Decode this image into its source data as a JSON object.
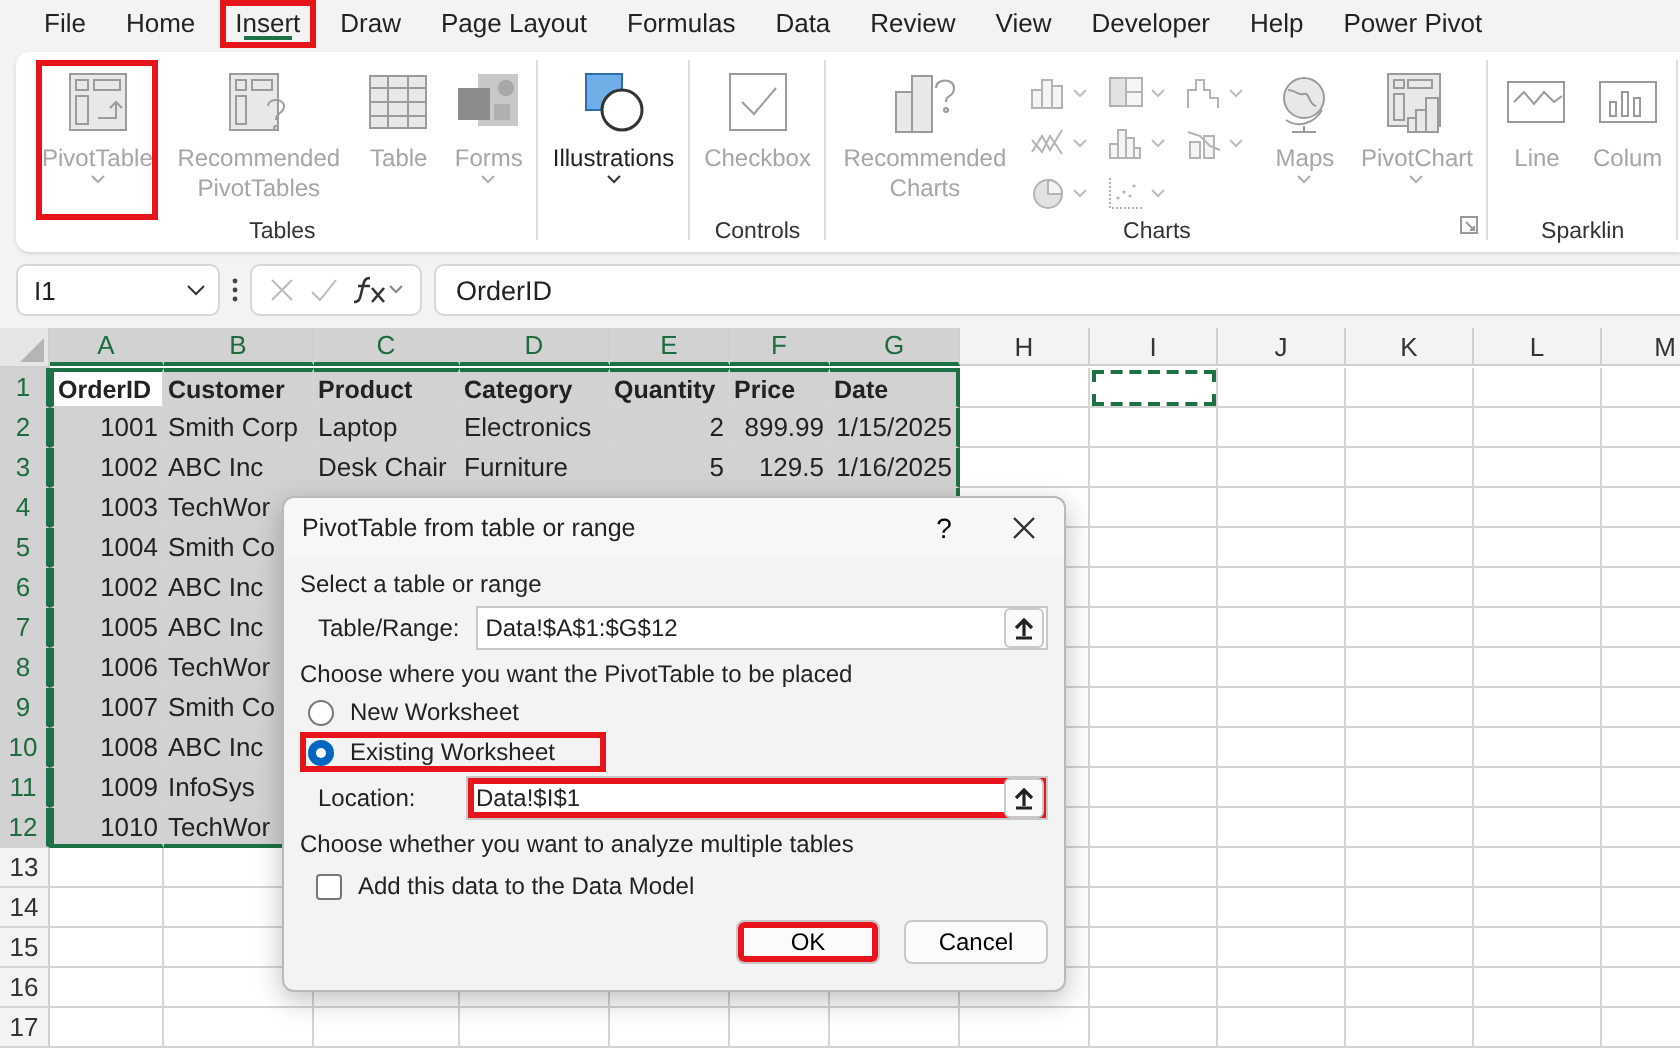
{
  "menu_tabs": [
    {
      "label": "File",
      "selected": false,
      "highlighted": false
    },
    {
      "label": "Home",
      "selected": false,
      "highlighted": false
    },
    {
      "label": "Insert",
      "selected": true,
      "highlighted": true
    },
    {
      "label": "Draw",
      "selected": false,
      "highlighted": false
    },
    {
      "label": "Page Layout",
      "selected": false,
      "highlighted": false
    },
    {
      "label": "Formulas",
      "selected": false,
      "highlighted": false
    },
    {
      "label": "Data",
      "selected": false,
      "highlighted": false
    },
    {
      "label": "Review",
      "selected": false,
      "highlighted": false
    },
    {
      "label": "View",
      "selected": false,
      "highlighted": false
    },
    {
      "label": "Developer",
      "selected": false,
      "highlighted": false
    },
    {
      "label": "Help",
      "selected": false,
      "highlighted": false
    },
    {
      "label": "Power Pivot",
      "selected": false,
      "highlighted": false
    }
  ],
  "ribbon": {
    "groups": [
      {
        "label": "Tables",
        "items": [
          {
            "kind": "pivottable",
            "label": "PivotTable",
            "dropdown": true,
            "disabled": true,
            "highlighted": true
          },
          {
            "kind": "recommended",
            "label": "Recommended PivotTables",
            "dropdown": false,
            "disabled": true,
            "highlighted": false
          },
          {
            "kind": "table",
            "label": "Table",
            "dropdown": false,
            "disabled": true,
            "highlighted": false
          },
          {
            "kind": "forms",
            "label": "Forms",
            "dropdown": true,
            "disabled": true,
            "highlighted": false
          }
        ]
      },
      {
        "items": [
          {
            "kind": "illustrations",
            "label": "Illustrations",
            "dropdown": true,
            "disabled": false,
            "highlighted": false
          }
        ]
      },
      {
        "label": "Controls",
        "items": [
          {
            "kind": "checkbox",
            "label": "Checkbox",
            "dropdown": false,
            "disabled": true,
            "highlighted": false
          }
        ]
      },
      {
        "label": "Charts",
        "launcher": true,
        "items": [
          {
            "kind": "recchart",
            "label": "Recommended Charts",
            "dropdown": false,
            "disabled": true,
            "highlighted": false
          },
          {
            "kind": "gallery",
            "disabled": true
          },
          {
            "kind": "maps",
            "label": "Maps",
            "dropdown": true,
            "disabled": true,
            "highlighted": false
          },
          {
            "kind": "pivotchart",
            "label": "PivotChart",
            "dropdown": true,
            "disabled": true,
            "highlighted": false
          }
        ]
      },
      {
        "label": "Sparklin",
        "items": [
          {
            "kind": "sparkline",
            "label": "Line",
            "dropdown": false,
            "disabled": true,
            "highlighted": false
          },
          {
            "kind": "sparkcolumn",
            "label": "Colum",
            "dropdown": false,
            "disabled": true,
            "highlighted": false
          }
        ]
      }
    ]
  },
  "formula_bar": {
    "name_box": "I1",
    "formula": "OrderID"
  },
  "sheet": {
    "marquee": true,
    "columns": [
      {
        "label": "A",
        "selected": true,
        "numeric": true
      },
      {
        "label": "B",
        "selected": true,
        "numeric": false
      },
      {
        "label": "C",
        "selected": true,
        "numeric": false
      },
      {
        "label": "D",
        "selected": true,
        "numeric": false
      },
      {
        "label": "E",
        "selected": true,
        "numeric": true
      },
      {
        "label": "F",
        "selected": true,
        "numeric": true
      },
      {
        "label": "G",
        "selected": true,
        "numeric": true
      },
      {
        "label": "H",
        "selected": false
      },
      {
        "label": "I",
        "selected": false
      },
      {
        "label": "J",
        "selected": false
      },
      {
        "label": "K",
        "selected": false
      },
      {
        "label": "L",
        "selected": false
      },
      {
        "label": "M",
        "selected": false
      }
    ],
    "rows": [
      {
        "label": "1",
        "selected": true,
        "kind": "header",
        "cells": [
          "OrderID",
          "Customer",
          "Product",
          "Category",
          "Quantity",
          "Price",
          "Date"
        ]
      },
      {
        "label": "2",
        "selected": true,
        "kind": "data",
        "cells": [
          "1001",
          "Smith Corp",
          "Laptop",
          "Electronics",
          "2",
          "899.99",
          "1/15/2025"
        ]
      },
      {
        "label": "3",
        "selected": true,
        "kind": "data",
        "cells": [
          "1002",
          "ABC Inc",
          "Desk Chair",
          "Furniture",
          "5",
          "129.5",
          "1/16/2025"
        ]
      },
      {
        "label": "4",
        "selected": true,
        "kind": "data",
        "cells": [
          "1003",
          "TechWor"
        ]
      },
      {
        "label": "5",
        "selected": true,
        "kind": "data",
        "cells": [
          "1004",
          "Smith Co"
        ]
      },
      {
        "label": "6",
        "selected": true,
        "kind": "data",
        "cells": [
          "1002",
          "ABC Inc"
        ]
      },
      {
        "label": "7",
        "selected": true,
        "kind": "data",
        "cells": [
          "1005",
          "ABC Inc"
        ]
      },
      {
        "label": "8",
        "selected": true,
        "kind": "data",
        "cells": [
          "1006",
          "TechWor"
        ]
      },
      {
        "label": "9",
        "selected": true,
        "kind": "data",
        "cells": [
          "1007",
          "Smith Co"
        ]
      },
      {
        "label": "10",
        "selected": true,
        "kind": "data",
        "cells": [
          "1008",
          "ABC Inc"
        ]
      },
      {
        "label": "11",
        "selected": true,
        "kind": "data",
        "cells": [
          "1009",
          "InfoSys"
        ]
      },
      {
        "label": "12",
        "selected": true,
        "kind": "data",
        "cells": [
          "1010",
          "TechWor"
        ]
      },
      {
        "label": "13",
        "selected": false,
        "kind": "data"
      },
      {
        "label": "14",
        "selected": false,
        "kind": "data"
      },
      {
        "label": "15",
        "selected": false,
        "kind": "data"
      },
      {
        "label": "16",
        "selected": false,
        "kind": "data"
      },
      {
        "label": "17",
        "selected": false,
        "kind": "data"
      }
    ]
  },
  "dialog": {
    "title": "PivotTable from table or range",
    "help": "?",
    "select_label": "Select a table or range",
    "range": {
      "label": "Table/Range:",
      "value": "Data!$A$1:$G$12"
    },
    "placement_label": "Choose where you want the PivotTable to be placed",
    "options": [
      {
        "label": "New Worksheet",
        "selected": false,
        "highlighted": false
      },
      {
        "label": "Existing Worksheet",
        "selected": true,
        "highlighted": true
      }
    ],
    "location": {
      "label": "Location:",
      "value": "Data!$I$1",
      "highlighted": true
    },
    "multi_label": "Choose whether you want to analyze multiple tables",
    "data_model": {
      "label": "Add this data to the Data Model",
      "checked": false
    },
    "buttons": [
      {
        "label": "OK",
        "highlighted": true
      },
      {
        "label": "Cancel",
        "highlighted": false
      }
    ]
  }
}
